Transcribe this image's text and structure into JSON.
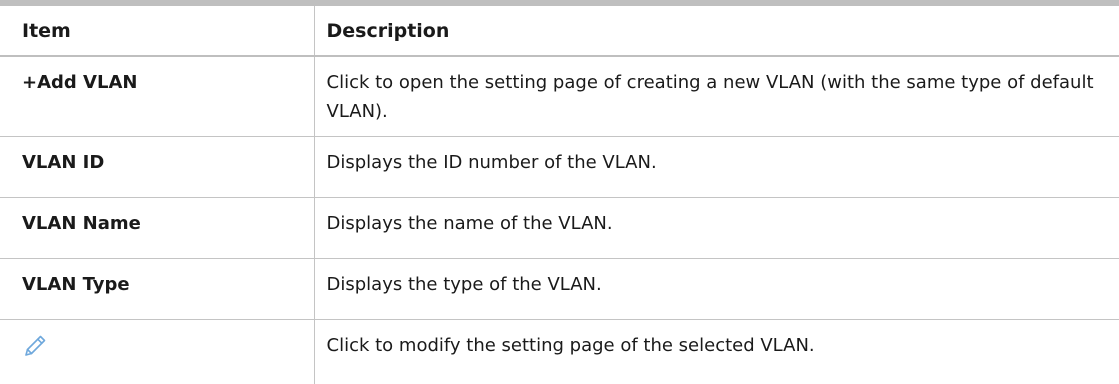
{
  "table": {
    "headers": {
      "item": "Item",
      "description": "Description"
    },
    "rows": [
      {
        "item": "+Add VLAN",
        "description": "Click to open the setting page of creating a new VLAN (with the same type of default VLAN)."
      },
      {
        "item": "VLAN ID",
        "description": "Displays the ID number of the VLAN."
      },
      {
        "item": "VLAN Name",
        "description": "Displays the name of the VLAN."
      },
      {
        "item": "VLAN Type",
        "description": "Displays the type of the VLAN."
      },
      {
        "item_icon": "pencil-edit-icon",
        "description": "Click to modify the setting page of the selected VLAN."
      }
    ]
  },
  "colors": {
    "rule": "#bfbfbf",
    "grid": "#c4c4c4",
    "icon": "#6fa8dc"
  }
}
